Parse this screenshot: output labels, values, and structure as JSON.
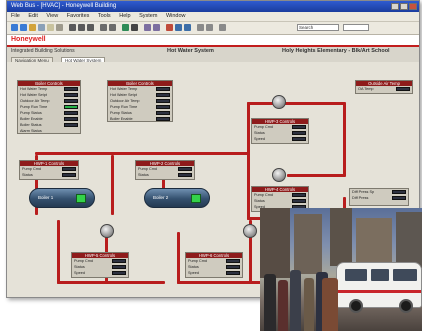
{
  "window": {
    "title": "Web Bus - [HVAC] - Honeywell Building"
  },
  "menu": [
    "File",
    "Edit",
    "View",
    "Favorites",
    "Tools",
    "Help",
    "System",
    "Window"
  ],
  "toolbar": {
    "field_text": "Search"
  },
  "header": {
    "logo": "Honeywell",
    "system_title": "Hot Water System",
    "site_title": "Holy Heights Elementary - Blk/Art School"
  },
  "subbar": {
    "breadcrumb": "Integrated Building Solutions"
  },
  "tabs": [
    {
      "label": "Navigation Menu"
    },
    {
      "label": "Hot Water System"
    }
  ],
  "panels": {
    "top_left": {
      "title": "Boiler Controls",
      "rows": [
        "Hot Water Temp",
        "Hot Water Setpt",
        "Outdoor Air Temp",
        "Pump Run Time",
        "Pump Status",
        "Boiler Enable",
        "Boiler Status",
        "Alarm Status"
      ]
    },
    "top_center": {
      "title": "Boiler Controls",
      "rows": [
        "Hot Water Temp",
        "Hot Water Setpt",
        "Outdoor Air Temp",
        "Pump Run Time",
        "Pump Status",
        "Boiler Enable"
      ]
    },
    "mid_left": {
      "title": "HWP-1 Controls",
      "rows": [
        "Pump Cmd",
        "Status"
      ]
    },
    "mid_center": {
      "title": "HWP-2 Controls",
      "rows": [
        "Pump Cmd",
        "Status"
      ]
    },
    "right_upper": {
      "title": "HWP-3 Controls",
      "rows": [
        "Pump Cmd",
        "Status",
        "Speed"
      ]
    },
    "right_lower": {
      "title": "HWP-4 Controls",
      "rows": [
        "Pump Cmd",
        "Status",
        "Speed"
      ]
    },
    "bottom_left": {
      "title": "HWP-5 Controls",
      "rows": [
        "Pump Cmd",
        "Status",
        "Speed"
      ]
    },
    "bottom_center": {
      "title": "HWP-6 Controls",
      "rows": [
        "Pump Cmd",
        "Status",
        "Speed"
      ]
    },
    "far_right": {
      "title": "Outside Air Temp",
      "rows": [
        "OA Temp"
      ]
    },
    "far_right_lower": {
      "title": "Diff Press",
      "rows": [
        "Diff Press Sp",
        "Diff Press"
      ]
    }
  },
  "tanks": [
    {
      "label": "Boiler 1"
    },
    {
      "label": "Boiler 2"
    }
  ],
  "colors": {
    "pipe": "#b81d1d",
    "header_accent": "#c21d1d",
    "status_green": "#27b34a"
  }
}
